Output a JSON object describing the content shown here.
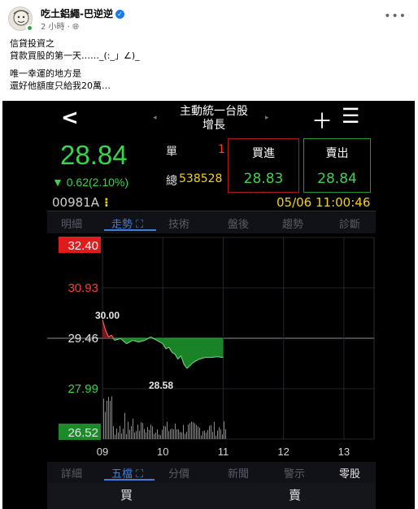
{
  "post": {
    "author": "吃土鋁繩-巴逆逆",
    "time": "2 小時 ·",
    "lines": [
      "信貸投資之",
      "貸款買股的第一天……_(:_」∠)_",
      "",
      "唯一幸運的地方是",
      "還好他額度只給我20萬…"
    ]
  },
  "app": {
    "title_line1": "主動統一台股",
    "title_line2": "增長",
    "price": "28.84",
    "change": "▼ 0.62(2.10%)",
    "unit_label": "單",
    "unit_value": "1",
    "total_label": "總",
    "total_value": "538528",
    "buy_label": "買進",
    "buy_price": "28.83",
    "sell_label": "賣出",
    "sell_price": "28.84",
    "code": "00981A",
    "code_mark": "⁝",
    "datetime": "05/06 11:00:46",
    "tabs": [
      "明細",
      "走勢",
      "技術",
      "盤後",
      "趨勢",
      "診斷"
    ],
    "active_tab_icon": "⛶",
    "bottom_tabs": [
      "詳細",
      "五檔",
      "分價",
      "新聞",
      "警示",
      "零股"
    ],
    "buy_header": "買",
    "sell_header": "賣"
  },
  "chart_data": {
    "type": "line",
    "title": "",
    "xlabel": "",
    "ylabel": "",
    "x_ticks": [
      "09",
      "10",
      "11",
      "12",
      "13"
    ],
    "y_ticks": [
      "32.40",
      "30.93",
      "29.46",
      "27.99",
      "26.52"
    ],
    "ylim": [
      26.52,
      32.4
    ],
    "reference": 29.46,
    "high_label": "30.00",
    "low_label": "28.58",
    "series": [
      {
        "x": [
          9.0,
          9.05,
          9.1,
          9.15,
          9.2,
          9.3,
          9.4,
          9.5,
          9.6,
          9.7,
          9.8,
          9.9,
          10.0,
          10.05,
          10.1,
          10.15,
          10.2,
          10.25,
          10.3,
          10.35,
          10.4,
          10.5,
          10.6,
          10.7,
          10.8,
          10.9,
          11.0
        ],
        "values": [
          30.0,
          29.7,
          29.5,
          29.55,
          29.4,
          29.45,
          29.3,
          29.4,
          29.35,
          29.4,
          29.5,
          29.4,
          29.3,
          29.15,
          29.2,
          29.05,
          29.0,
          28.85,
          28.95,
          28.7,
          28.58,
          28.75,
          28.85,
          28.9,
          28.9,
          28.92,
          28.9
        ]
      }
    ],
    "volume_note": "grey volume bars"
  },
  "colors": {
    "up": "#ff3b3b",
    "down": "#37d64a",
    "accent": "#3f7fd9",
    "highlight": "#f5d20a"
  }
}
